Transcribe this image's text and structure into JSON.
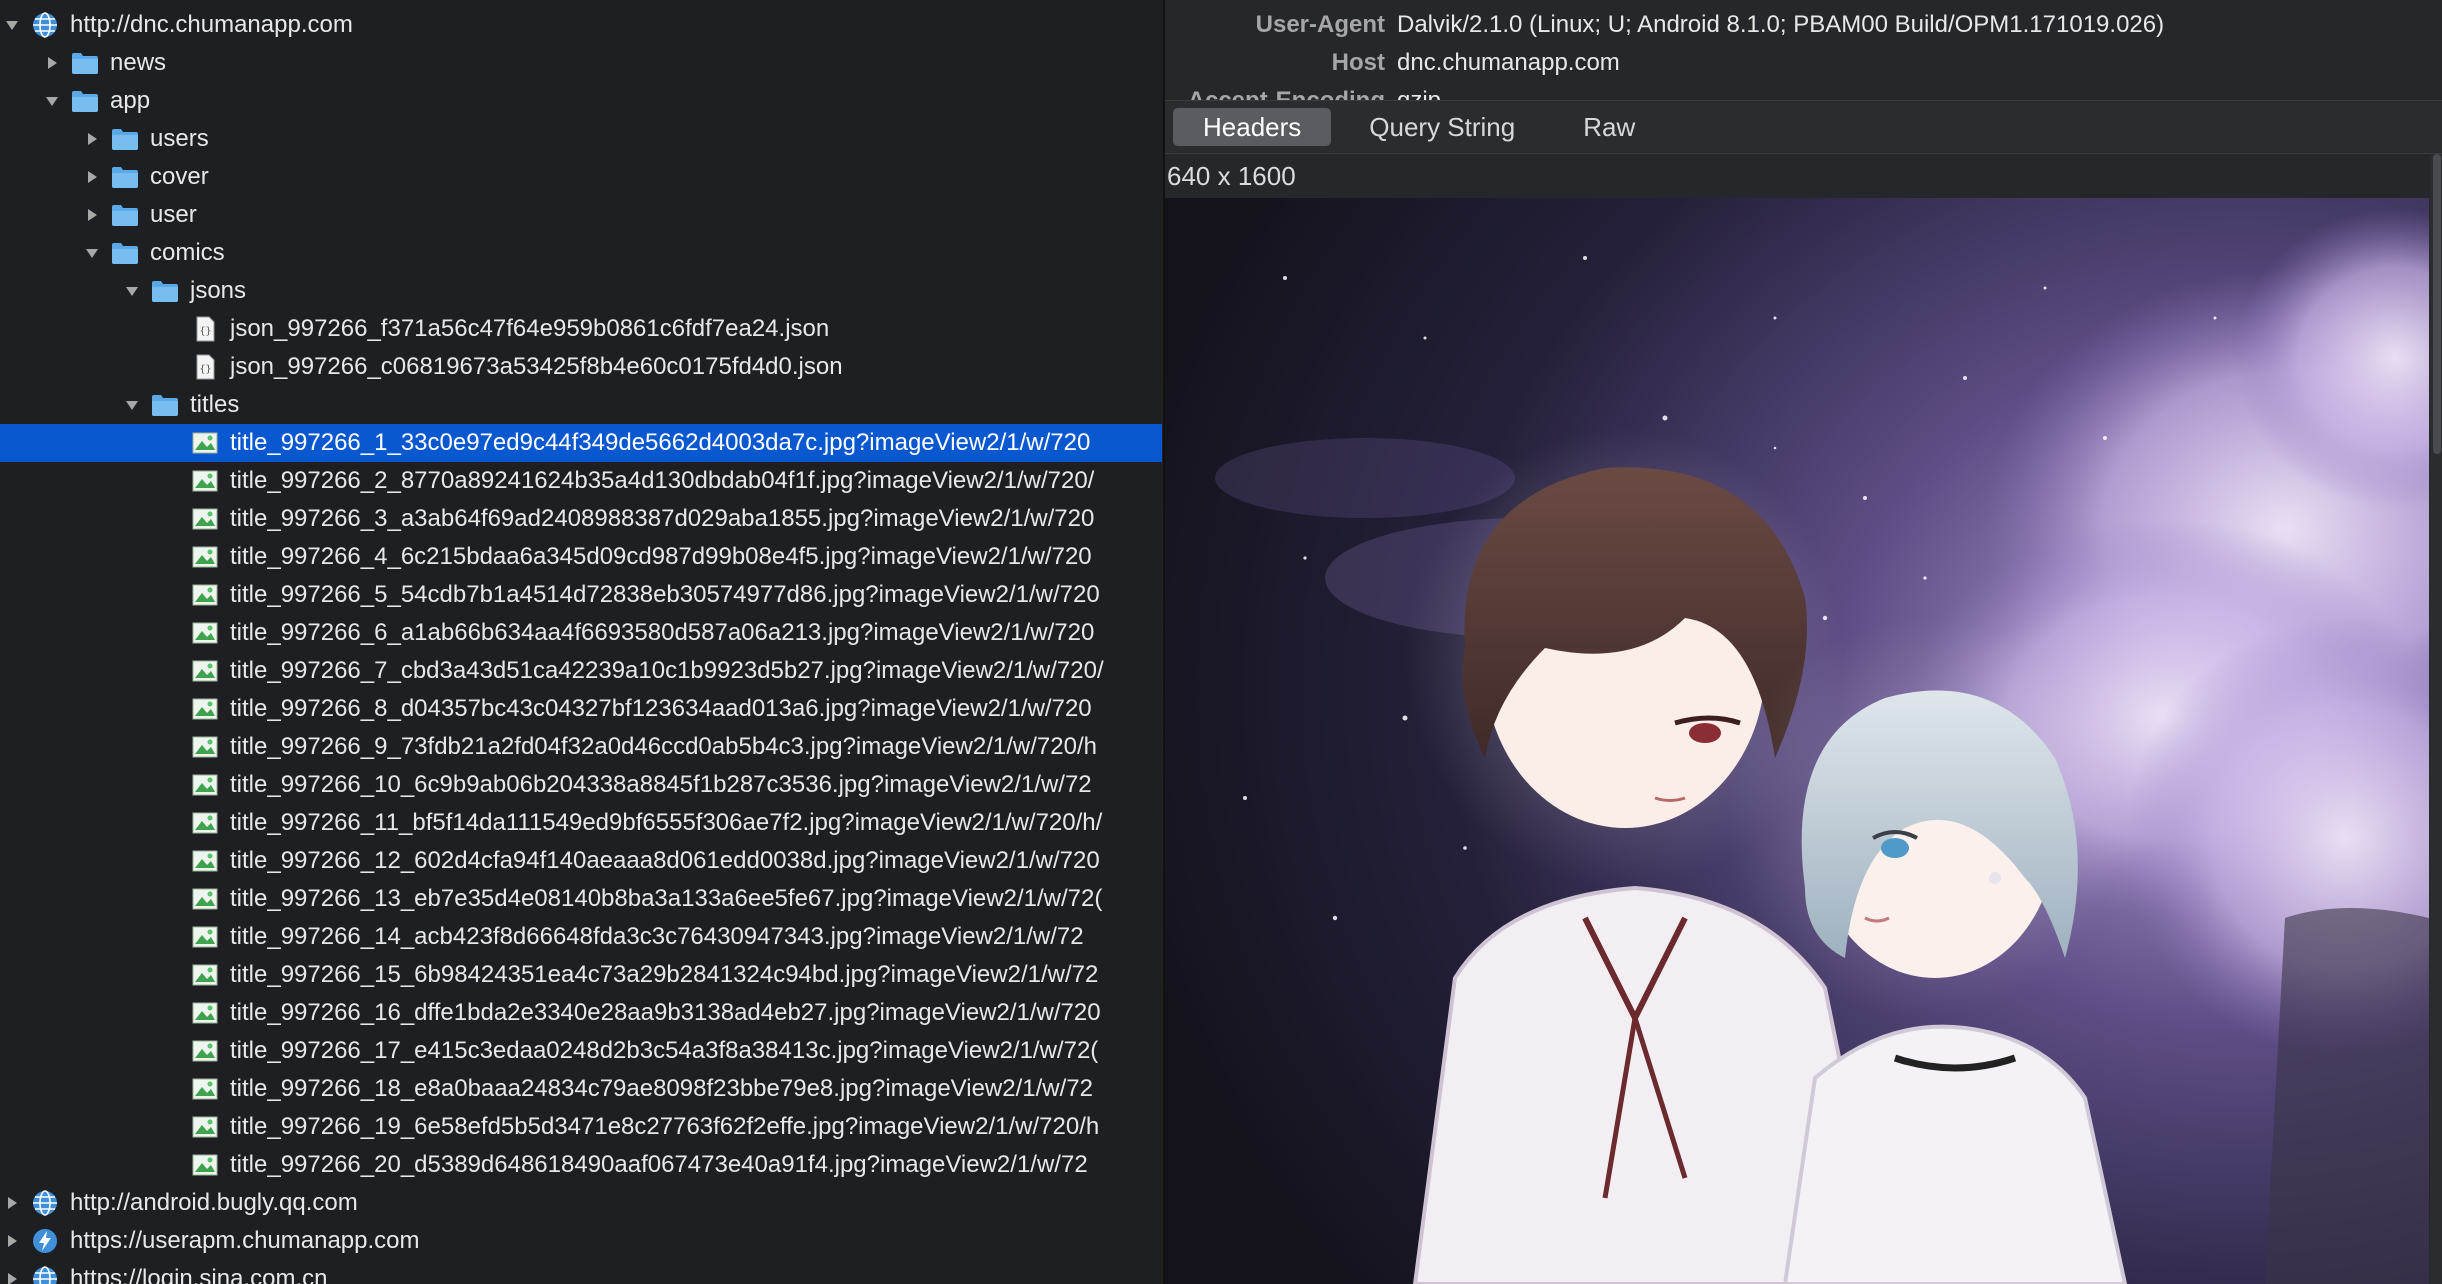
{
  "tree": {
    "rows": [
      {
        "label": "http://dnc.chumanapp.com",
        "kind": "globe",
        "indent": 0,
        "arrow": "down"
      },
      {
        "label": "news",
        "kind": "folder",
        "indent": 1,
        "arrow": "right"
      },
      {
        "label": "app",
        "kind": "folder",
        "indent": 1,
        "arrow": "down"
      },
      {
        "label": "users",
        "kind": "folder",
        "indent": 2,
        "arrow": "right"
      },
      {
        "label": "cover",
        "kind": "folder",
        "indent": 2,
        "arrow": "right"
      },
      {
        "label": "user",
        "kind": "folder",
        "indent": 2,
        "arrow": "right"
      },
      {
        "label": "comics",
        "kind": "folder",
        "indent": 2,
        "arrow": "down"
      },
      {
        "label": "jsons",
        "kind": "folder",
        "indent": 3,
        "arrow": "down"
      },
      {
        "label": "json_997266_f371a56c47f64e959b0861c6fdf7ea24.json",
        "kind": "json",
        "indent": 4,
        "arrow": "none"
      },
      {
        "label": "json_997266_c06819673a53425f8b4e60c0175fd4d0.json",
        "kind": "json",
        "indent": 4,
        "arrow": "none"
      },
      {
        "label": "titles",
        "kind": "folder",
        "indent": 3,
        "arrow": "down"
      },
      {
        "label": "title_997266_1_33c0e97ed9c44f349de5662d4003da7c.jpg?imageView2/1/w/720",
        "kind": "image",
        "indent": 4,
        "arrow": "none",
        "selected": true
      },
      {
        "label": "title_997266_2_8770a89241624b35a4d130dbdab04f1f.jpg?imageView2/1/w/720/",
        "kind": "image",
        "indent": 4,
        "arrow": "none"
      },
      {
        "label": "title_997266_3_a3ab64f69ad2408988387d029aba1855.jpg?imageView2/1/w/720",
        "kind": "image",
        "indent": 4,
        "arrow": "none"
      },
      {
        "label": "title_997266_4_6c215bdaa6a345d09cd987d99b08e4f5.jpg?imageView2/1/w/720",
        "kind": "image",
        "indent": 4,
        "arrow": "none"
      },
      {
        "label": "title_997266_5_54cdb7b1a4514d72838eb30574977d86.jpg?imageView2/1/w/720",
        "kind": "image",
        "indent": 4,
        "arrow": "none"
      },
      {
        "label": "title_997266_6_a1ab66b634aa4f6693580d587a06a213.jpg?imageView2/1/w/720",
        "kind": "image",
        "indent": 4,
        "arrow": "none"
      },
      {
        "label": "title_997266_7_cbd3a43d51ca42239a10c1b9923d5b27.jpg?imageView2/1/w/720/",
        "kind": "image",
        "indent": 4,
        "arrow": "none"
      },
      {
        "label": "title_997266_8_d04357bc43c04327bf123634aad013a6.jpg?imageView2/1/w/720",
        "kind": "image",
        "indent": 4,
        "arrow": "none"
      },
      {
        "label": "title_997266_9_73fdb21a2fd04f32a0d46ccd0ab5b4c3.jpg?imageView2/1/w/720/h",
        "kind": "image",
        "indent": 4,
        "arrow": "none"
      },
      {
        "label": "title_997266_10_6c9b9ab06b204338a8845f1b287c3536.jpg?imageView2/1/w/72",
        "kind": "image",
        "indent": 4,
        "arrow": "none"
      },
      {
        "label": "title_997266_11_bf5f14da111549ed9bf6555f306ae7f2.jpg?imageView2/1/w/720/h/",
        "kind": "image",
        "indent": 4,
        "arrow": "none"
      },
      {
        "label": "title_997266_12_602d4cfa94f140aeaaa8d061edd0038d.jpg?imageView2/1/w/720",
        "kind": "image",
        "indent": 4,
        "arrow": "none"
      },
      {
        "label": "title_997266_13_eb7e35d4e08140b8ba3a133a6ee5fe67.jpg?imageView2/1/w/72(",
        "kind": "image",
        "indent": 4,
        "arrow": "none"
      },
      {
        "label": "title_997266_14_acb423f8d66648fda3c3c76430947343.jpg?imageView2/1/w/72",
        "kind": "image",
        "indent": 4,
        "arrow": "none"
      },
      {
        "label": "title_997266_15_6b98424351ea4c73a29b2841324c94bd.jpg?imageView2/1/w/72",
        "kind": "image",
        "indent": 4,
        "arrow": "none"
      },
      {
        "label": "title_997266_16_dffe1bda2e3340e28aa9b3138ad4eb27.jpg?imageView2/1/w/720",
        "kind": "image",
        "indent": 4,
        "arrow": "none"
      },
      {
        "label": "title_997266_17_e415c3edaa0248d2b3c54a3f8a38413c.jpg?imageView2/1/w/72(",
        "kind": "image",
        "indent": 4,
        "arrow": "none"
      },
      {
        "label": "title_997266_18_e8a0baaa24834c79ae8098f23bbe79e8.jpg?imageView2/1/w/72",
        "kind": "image",
        "indent": 4,
        "arrow": "none"
      },
      {
        "label": "title_997266_19_6e58efd5b5d3471e8c27763f62f2effe.jpg?imageView2/1/w/720/h",
        "kind": "image",
        "indent": 4,
        "arrow": "none"
      },
      {
        "label": "title_997266_20_d5389d648618490aaf067473e40a91f4.jpg?imageView2/1/w/72",
        "kind": "image",
        "indent": 4,
        "arrow": "none"
      },
      {
        "label": "http://android.bugly.qq.com",
        "kind": "globe",
        "indent": 0,
        "arrow": "right"
      },
      {
        "label": "https://userapm.chumanapp.com",
        "kind": "bolt",
        "indent": 0,
        "arrow": "right"
      },
      {
        "label": "https://login.sina.com.cn",
        "kind": "globe",
        "indent": 0,
        "arrow": "right"
      }
    ]
  },
  "request_headers": {
    "rows": [
      {
        "key": "User-Agent",
        "value": "Dalvik/2.1.0 (Linux; U; Android 8.1.0; PBAM00 Build/OPM1.171019.026)"
      },
      {
        "key": "Host",
        "value": "dnc.chumanapp.com"
      },
      {
        "key": "Accept-Encoding",
        "value": "gzip"
      }
    ]
  },
  "tabs": [
    "Headers",
    "Query String",
    "Raw"
  ],
  "active_tab": "Headers",
  "image_dimensions": "640 x 1600",
  "colors": {
    "selection": "#0a58d0",
    "folder": "#5aa9e6"
  }
}
